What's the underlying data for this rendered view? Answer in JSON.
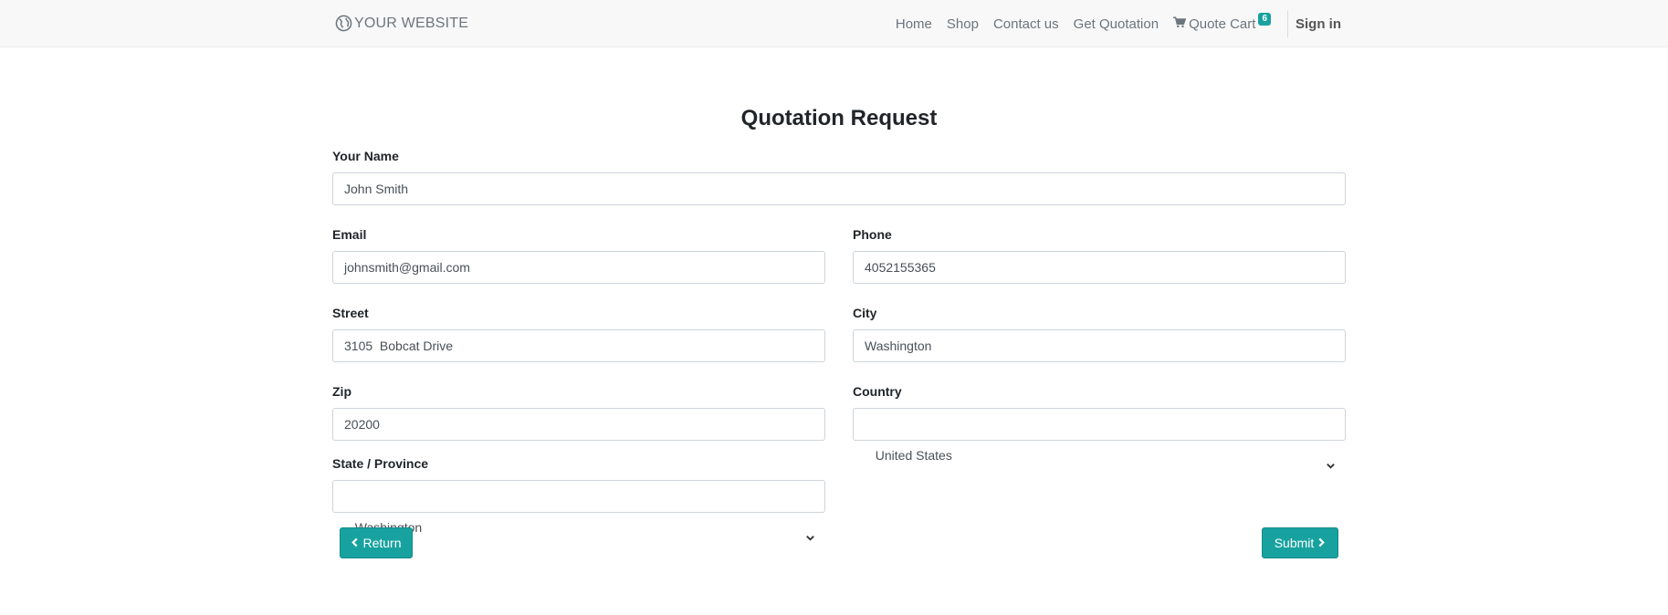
{
  "navbar": {
    "brand": "YOUR WEBSITE",
    "links": [
      "Home",
      "Shop",
      "Contact us",
      "Get Quotation"
    ],
    "cart_label": "Quote Cart",
    "cart_count": "6",
    "signin": "Sign in"
  },
  "form": {
    "title": "Quotation Request",
    "name_label": "Your Name",
    "name_value": "John Smith",
    "email_label": "Email",
    "email_value": "johnsmith@gmail.com",
    "phone_label": "Phone",
    "phone_value": "4052155365",
    "street_label": "Street",
    "street_value": "3105  Bobcat Drive",
    "city_label": "City",
    "city_value": "Washington",
    "zip_label": "Zip",
    "zip_value": "20200",
    "country_label": "Country",
    "country_value": "United States",
    "state_label": "State / Province",
    "state_value": "Washington"
  },
  "buttons": {
    "return": "Return",
    "submit": "Submit"
  },
  "colors": {
    "accent": "#17a2a0",
    "navbar_bg": "#f8f8f8"
  },
  "icons": [
    "globe-icon",
    "cart-icon",
    "chevron-left-icon",
    "chevron-right-icon",
    "chevron-down-icon"
  ]
}
